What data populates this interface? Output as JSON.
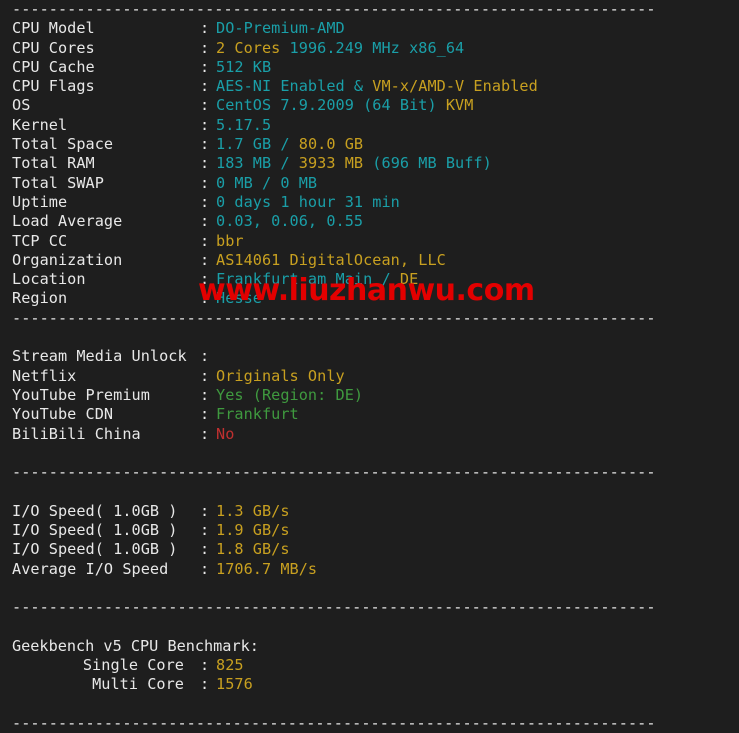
{
  "terminal": {
    "background": "#1e1e1e",
    "separator_text": "----------------------------------------------------------------------",
    "colors": {
      "cyan": "#1a9fa8",
      "yellow": "#c8a020",
      "green": "#3f9a3f",
      "red": "#c03030",
      "white": "#e8e8e8",
      "watermark": "#e30000"
    }
  },
  "watermark": {
    "text": "www.liuzhanwu.com"
  },
  "system_info": {
    "rows": [
      {
        "label": "CPU Model",
        "colon": ":",
        "parts": [
          {
            "t": "DO-Premium-AMD",
            "c": "cyan"
          }
        ]
      },
      {
        "label": "CPU Cores",
        "colon": ":",
        "parts": [
          {
            "t": "2 Cores",
            "c": "yellow"
          },
          {
            "t": " 1996.249 MHz x86_64",
            "c": "cyan"
          }
        ]
      },
      {
        "label": "CPU Cache",
        "colon": ":",
        "parts": [
          {
            "t": "512 KB",
            "c": "cyan"
          }
        ]
      },
      {
        "label": "CPU Flags",
        "colon": ":",
        "parts": [
          {
            "t": "AES-NI Enabled & ",
            "c": "cyan"
          },
          {
            "t": "VM-x/AMD-V Enabled",
            "c": "yellow"
          }
        ]
      },
      {
        "label": "OS",
        "colon": ":",
        "parts": [
          {
            "t": "CentOS 7.9.2009 (64 Bit) ",
            "c": "cyan"
          },
          {
            "t": "KVM",
            "c": "yellow"
          }
        ]
      },
      {
        "label": "Kernel",
        "colon": ":",
        "parts": [
          {
            "t": "5.17.5",
            "c": "cyan"
          }
        ]
      },
      {
        "label": "Total Space",
        "colon": ":",
        "parts": [
          {
            "t": "1.7 GB / ",
            "c": "cyan"
          },
          {
            "t": "80.0 GB",
            "c": "yellow"
          }
        ]
      },
      {
        "label": "Total RAM",
        "colon": ":",
        "parts": [
          {
            "t": "183 MB / ",
            "c": "cyan"
          },
          {
            "t": "3933 MB",
            "c": "yellow"
          },
          {
            "t": " (696 MB Buff)",
            "c": "cyan"
          }
        ]
      },
      {
        "label": "Total SWAP",
        "colon": ":",
        "parts": [
          {
            "t": "0 MB / 0 MB",
            "c": "cyan"
          }
        ]
      },
      {
        "label": "Uptime",
        "colon": ":",
        "parts": [
          {
            "t": "0 days 1 hour 31 min",
            "c": "cyan"
          }
        ]
      },
      {
        "label": "Load Average",
        "colon": ":",
        "parts": [
          {
            "t": "0.03, 0.06, 0.55",
            "c": "cyan"
          }
        ]
      },
      {
        "label": "TCP CC",
        "colon": ":",
        "parts": [
          {
            "t": "bbr",
            "c": "yellow"
          }
        ]
      },
      {
        "label": "Organization",
        "colon": ":",
        "parts": [
          {
            "t": "AS14061 DigitalOcean, LLC",
            "c": "yellow"
          }
        ]
      },
      {
        "label": "Location",
        "colon": ":",
        "parts": [
          {
            "t": "Frankfurt am Main / ",
            "c": "cyan"
          },
          {
            "t": "DE",
            "c": "yellow"
          }
        ]
      },
      {
        "label": "Region",
        "colon": ":",
        "parts": [
          {
            "t": "Hesse",
            "c": "cyan"
          }
        ]
      }
    ]
  },
  "stream_media": {
    "rows": [
      {
        "label": "Stream Media Unlock",
        "colon": ":",
        "parts": []
      },
      {
        "label": "Netflix",
        "colon": ":",
        "parts": [
          {
            "t": "Originals Only",
            "c": "yellow"
          }
        ]
      },
      {
        "label": "YouTube Premium",
        "colon": ":",
        "parts": [
          {
            "t": "Yes (Region: DE)",
            "c": "green"
          }
        ]
      },
      {
        "label": "YouTube CDN",
        "colon": ":",
        "parts": [
          {
            "t": "Frankfurt",
            "c": "green"
          }
        ]
      },
      {
        "label": "BiliBili China",
        "colon": ":",
        "parts": [
          {
            "t": "No",
            "c": "red"
          }
        ]
      }
    ]
  },
  "io_speed": {
    "rows": [
      {
        "label": "I/O Speed( 1.0GB )",
        "colon": ":",
        "parts": [
          {
            "t": "1.3 GB/s",
            "c": "yellow"
          }
        ]
      },
      {
        "label": "I/O Speed( 1.0GB )",
        "colon": ":",
        "parts": [
          {
            "t": "1.9 GB/s",
            "c": "yellow"
          }
        ]
      },
      {
        "label": "I/O Speed( 1.0GB )",
        "colon": ":",
        "parts": [
          {
            "t": "1.8 GB/s",
            "c": "yellow"
          }
        ]
      },
      {
        "label": "Average I/O Speed",
        "colon": ":",
        "parts": [
          {
            "t": "1706.7 MB/s",
            "c": "yellow"
          }
        ]
      }
    ]
  },
  "geekbench": {
    "heading": "Geekbench v5 CPU Benchmark:",
    "rows": [
      {
        "label": "Single Core",
        "colon": ":",
        "align": "right",
        "parts": [
          {
            "t": "825",
            "c": "yellow"
          }
        ]
      },
      {
        "label": "Multi Core",
        "colon": ":",
        "align": "right",
        "parts": [
          {
            "t": "1576",
            "c": "yellow"
          }
        ]
      }
    ]
  }
}
